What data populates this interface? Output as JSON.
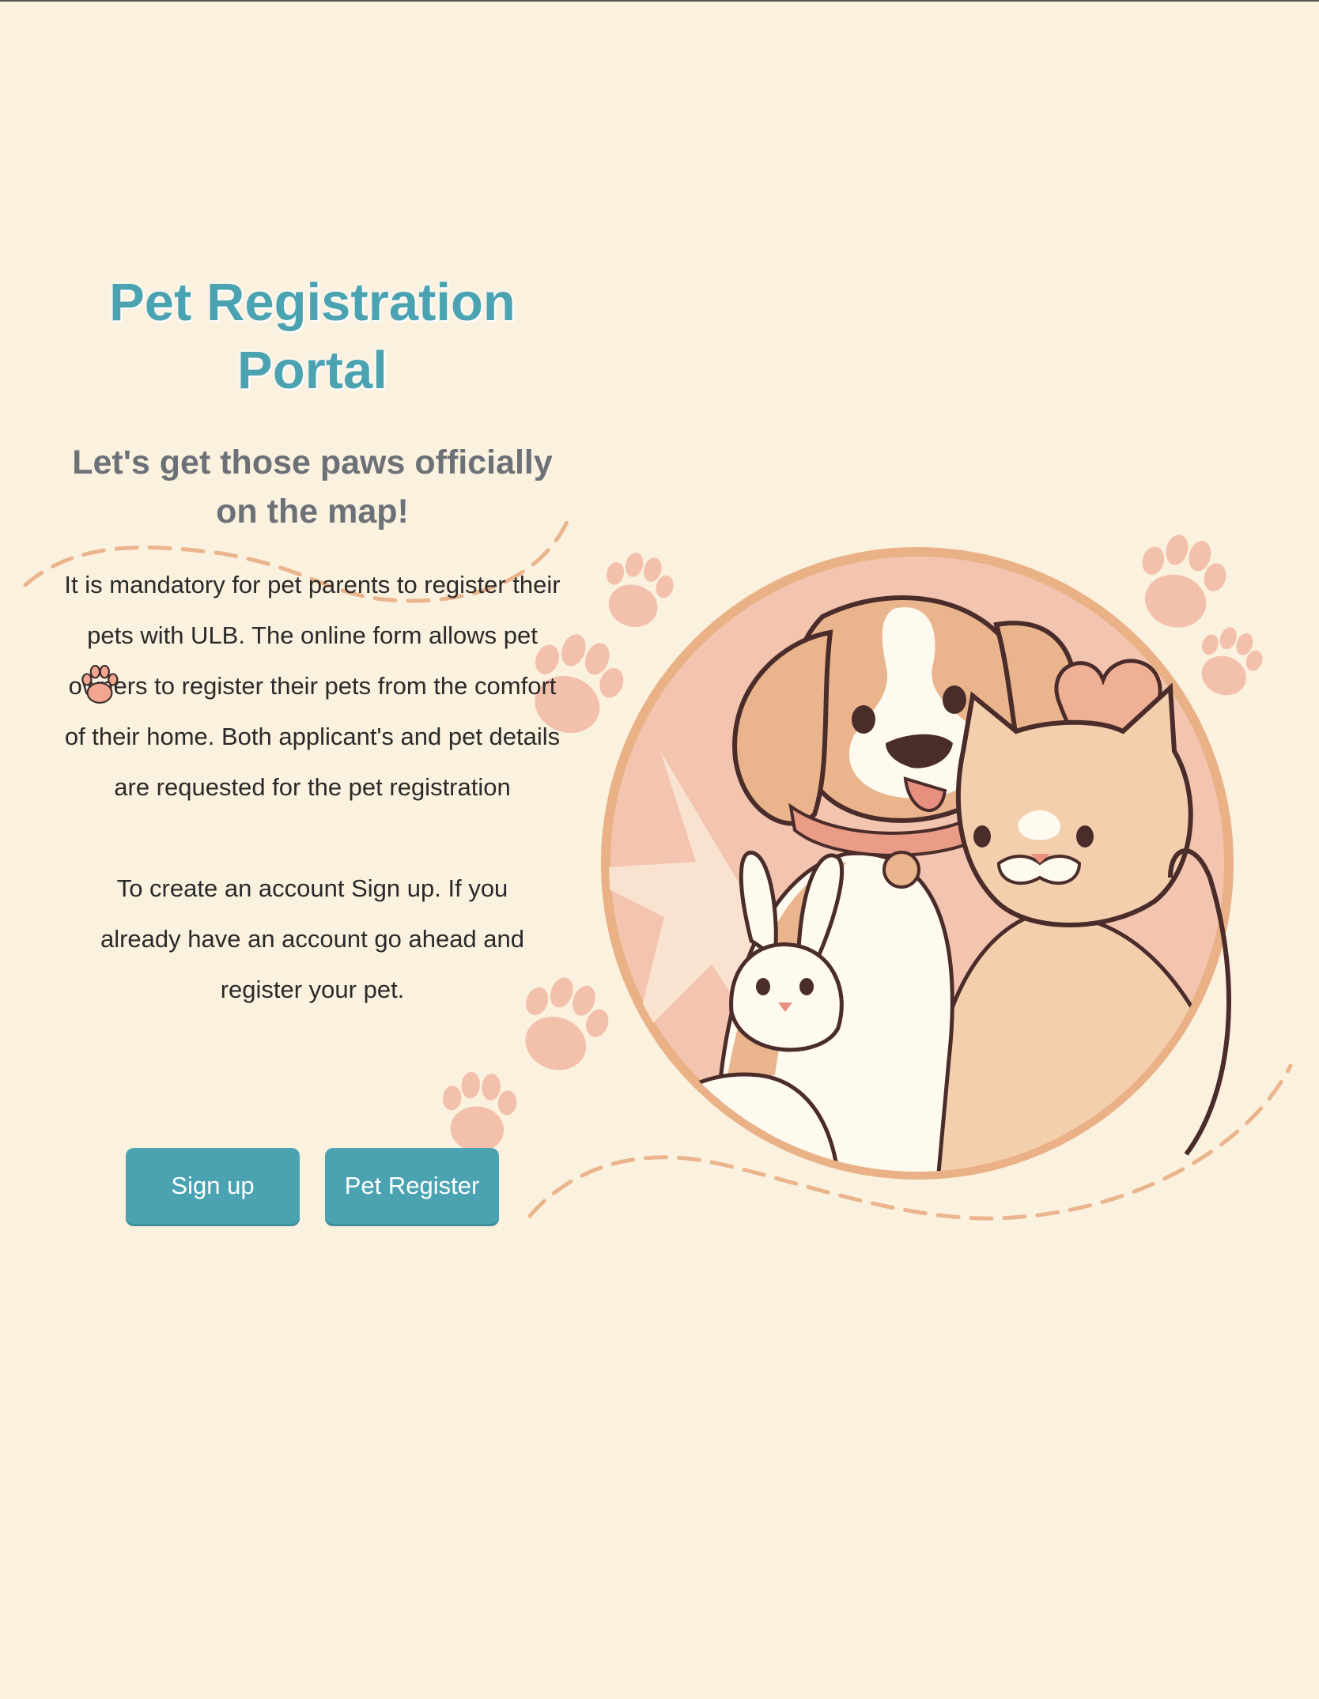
{
  "header": {
    "title": "Pet Registration Portal",
    "subtitle": "Let's get those paws officially on the map!"
  },
  "content": {
    "intro": "It is mandatory for pet parents to register their pets with ULB. The online form allows pet owners to register their pets from the comfort of their home. Both applicant's and pet details are requested for the pet registration",
    "account_note": "To create an account Sign up. If you already have an account go ahead and register your pet."
  },
  "actions": {
    "signup_label": "Sign up",
    "pet_register_label": "Pet Register"
  },
  "illustration": {
    "subject": "dog, cat and rabbit in a circle with hearts and paw prints",
    "icons": [
      "paw-print-icon",
      "heart-icon"
    ]
  },
  "colors": {
    "background": "#fbf1df",
    "accent": "#4ba3b2",
    "subtitle": "#6c7178",
    "paw": "#f2b8a4",
    "ring": "#e9b185",
    "dashed_line": "#eab48c"
  }
}
